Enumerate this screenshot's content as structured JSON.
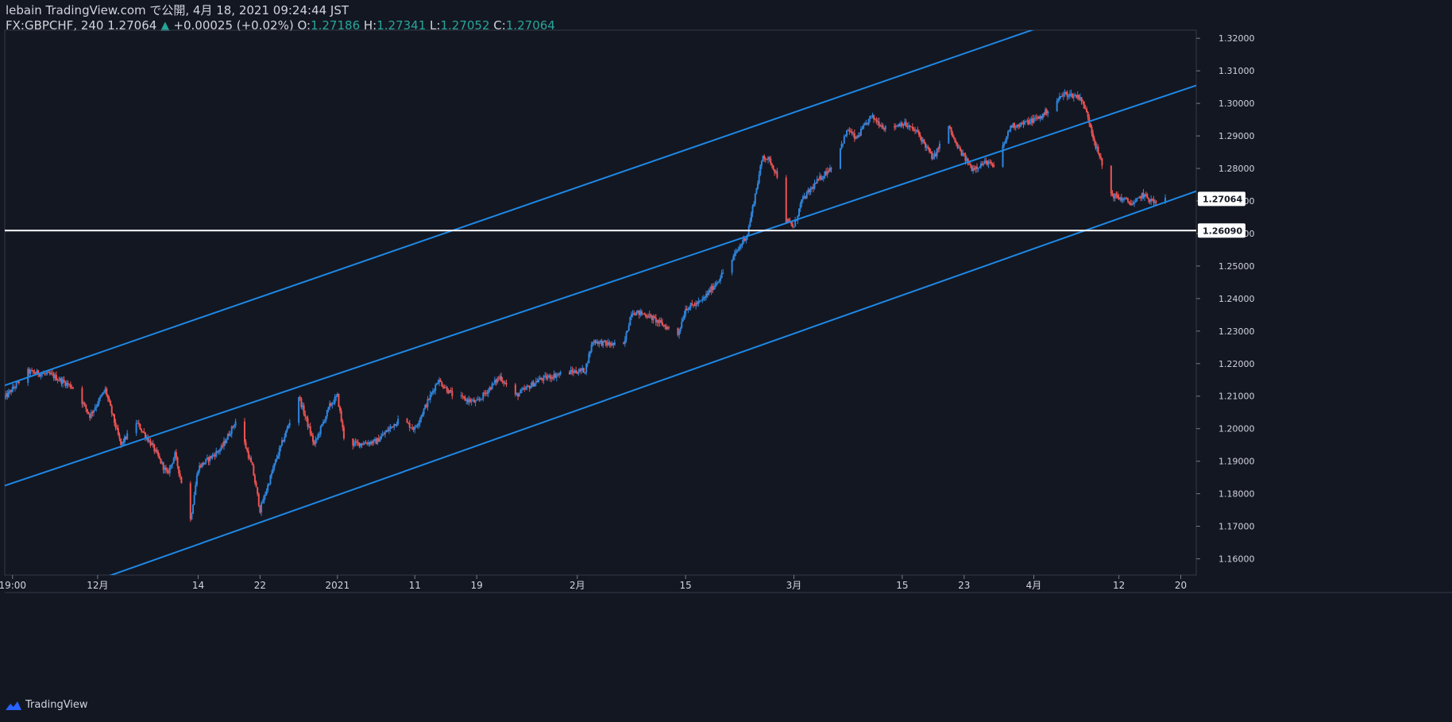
{
  "header": {
    "publisher": "lebain TradingView.com で公開, 4月 18, 2021 09:24:44 JST",
    "symbol": "FX:GBPCHF, 240",
    "last": "1.27064",
    "change_arrow": "▲",
    "change": "+0.00025 (+0.02%)",
    "o_label": "O:",
    "o": "1.27186",
    "h_label": "H:",
    "h": "1.27341",
    "l_label": "L:",
    "l": "1.27052",
    "c_label": "C:",
    "c": "1.27064"
  },
  "footer": {
    "brand": "TradingView",
    "logo_icon": "tradingview-logo-icon"
  },
  "colors": {
    "background": "#131722",
    "up": "#2e86de",
    "down": "#ef5350",
    "channel": "#1e88e5",
    "hline": "#ffffff",
    "axis_text": "#d1d4dc",
    "ohlc": "#26a69a"
  },
  "chart_data": {
    "type": "candlestick",
    "y_axis": {
      "range": [
        1.155,
        1.3225
      ],
      "ticks": [
        "1.16000",
        "1.17000",
        "1.18000",
        "1.19000",
        "1.20000",
        "1.21000",
        "1.22000",
        "1.23000",
        "1.24000",
        "1.25000",
        "1.26000",
        "1.27000",
        "1.28000",
        "1.29000",
        "1.30000",
        "1.31000",
        "1.32000"
      ],
      "tick_values": [
        1.16,
        1.17,
        1.18,
        1.19,
        1.2,
        1.21,
        1.22,
        1.23,
        1.24,
        1.25,
        1.26,
        1.27,
        1.28,
        1.29,
        1.3,
        1.31,
        1.32
      ]
    },
    "x_axis": {
      "range": [
        "2020-11-19",
        "2021-04-22"
      ],
      "ticks": [
        {
          "label": "19:00",
          "date": "2020-11-20"
        },
        {
          "label": "12月",
          "date": "2020-12-01"
        },
        {
          "label": "14",
          "date": "2020-12-14"
        },
        {
          "label": "22",
          "date": "2020-12-22"
        },
        {
          "label": "2021",
          "date": "2021-01-01"
        },
        {
          "label": "11",
          "date": "2021-01-11"
        },
        {
          "label": "19",
          "date": "2021-01-19"
        },
        {
          "label": "2月",
          "date": "2021-02-01"
        },
        {
          "label": "15",
          "date": "2021-02-15"
        },
        {
          "label": "3月",
          "date": "2021-03-01"
        },
        {
          "label": "15",
          "date": "2021-03-15"
        },
        {
          "label": "23",
          "date": "2021-03-23"
        },
        {
          "label": "4月",
          "date": "2021-04-01"
        },
        {
          "label": "12",
          "date": "2021-04-12"
        },
        {
          "label": "20",
          "date": "2021-04-20"
        }
      ]
    },
    "series": [
      {
        "name": "GBPCHF",
        "close_path": [
          {
            "date": "2020-11-19",
            "price": 1.2095
          },
          {
            "date": "2020-11-22",
            "price": 1.2175
          },
          {
            "date": "2020-11-25",
            "price": 1.2165
          },
          {
            "date": "2020-11-28",
            "price": 1.2125
          },
          {
            "date": "2020-11-30",
            "price": 1.204
          },
          {
            "date": "2020-12-02",
            "price": 1.212
          },
          {
            "date": "2020-12-04",
            "price": 1.195
          },
          {
            "date": "2020-12-06",
            "price": 1.202
          },
          {
            "date": "2020-12-08",
            "price": 1.195
          },
          {
            "date": "2020-12-10",
            "price": 1.186
          },
          {
            "date": "2020-12-11",
            "price": 1.192
          },
          {
            "date": "2020-12-13",
            "price": 1.172
          },
          {
            "date": "2020-12-14",
            "price": 1.188
          },
          {
            "date": "2020-12-17",
            "price": 1.194
          },
          {
            "date": "2020-12-19",
            "price": 1.203
          },
          {
            "date": "2020-12-21",
            "price": 1.188
          },
          {
            "date": "2020-12-22",
            "price": 1.175
          },
          {
            "date": "2020-12-24",
            "price": 1.19
          },
          {
            "date": "2020-12-27",
            "price": 1.21
          },
          {
            "date": "2020-12-29",
            "price": 1.195
          },
          {
            "date": "2020-12-31",
            "price": 1.207
          },
          {
            "date": "2021-01-01",
            "price": 1.21
          },
          {
            "date": "2021-01-02",
            "price": 1.195
          },
          {
            "date": "2021-01-06",
            "price": 1.196
          },
          {
            "date": "2021-01-09",
            "price": 1.203
          },
          {
            "date": "2021-01-11",
            "price": 1.2
          },
          {
            "date": "2021-01-14",
            "price": 1.215
          },
          {
            "date": "2021-01-16",
            "price": 1.21
          },
          {
            "date": "2021-01-19",
            "price": 1.208
          },
          {
            "date": "2021-01-22",
            "price": 1.216
          },
          {
            "date": "2021-01-24",
            "price": 1.21
          },
          {
            "date": "2021-01-27",
            "price": 1.215
          },
          {
            "date": "2021-01-30",
            "price": 1.217
          },
          {
            "date": "2021-02-02",
            "price": 1.218
          },
          {
            "date": "2021-02-03",
            "price": 1.227
          },
          {
            "date": "2021-02-05",
            "price": 1.226
          },
          {
            "date": "2021-02-07",
            "price": 1.2255
          },
          {
            "date": "2021-02-08",
            "price": 1.236
          },
          {
            "date": "2021-02-10",
            "price": 1.235
          },
          {
            "date": "2021-02-12",
            "price": 1.232
          },
          {
            "date": "2021-02-14",
            "price": 1.229
          },
          {
            "date": "2021-02-15",
            "price": 1.237
          },
          {
            "date": "2021-02-17",
            "price": 1.239
          },
          {
            "date": "2021-02-19",
            "price": 1.245
          },
          {
            "date": "2021-02-21",
            "price": 1.252
          },
          {
            "date": "2021-02-23",
            "price": 1.26
          },
          {
            "date": "2021-02-24",
            "price": 1.272
          },
          {
            "date": "2021-02-25",
            "price": 1.284
          },
          {
            "date": "2021-02-26",
            "price": 1.282
          },
          {
            "date": "2021-02-27",
            "price": 1.277
          },
          {
            "date": "2021-02-28",
            "price": 1.264
          },
          {
            "date": "2021-03-01",
            "price": 1.262
          },
          {
            "date": "2021-03-02",
            "price": 1.27
          },
          {
            "date": "2021-03-04",
            "price": 1.276
          },
          {
            "date": "2021-03-06",
            "price": 1.281
          },
          {
            "date": "2021-03-08",
            "price": 1.292
          },
          {
            "date": "2021-03-09",
            "price": 1.289
          },
          {
            "date": "2021-03-11",
            "price": 1.296
          },
          {
            "date": "2021-03-13",
            "price": 1.292
          },
          {
            "date": "2021-03-15",
            "price": 1.294
          },
          {
            "date": "2021-03-17",
            "price": 1.291
          },
          {
            "date": "2021-03-19",
            "price": 1.283
          },
          {
            "date": "2021-03-21",
            "price": 1.293
          },
          {
            "date": "2021-03-22",
            "price": 1.287
          },
          {
            "date": "2021-03-24",
            "price": 1.28
          },
          {
            "date": "2021-03-26",
            "price": 1.282
          },
          {
            "date": "2021-03-27",
            "price": 1.28
          },
          {
            "date": "2021-03-29",
            "price": 1.293
          },
          {
            "date": "2021-03-31",
            "price": 1.294
          },
          {
            "date": "2021-04-02",
            "price": 1.296
          },
          {
            "date": "2021-04-04",
            "price": 1.301
          },
          {
            "date": "2021-04-05",
            "price": 1.303
          },
          {
            "date": "2021-04-07",
            "price": 1.302
          },
          {
            "date": "2021-04-08",
            "price": 1.296
          },
          {
            "date": "2021-04-09",
            "price": 1.287
          },
          {
            "date": "2021-04-10",
            "price": 1.28
          },
          {
            "date": "2021-04-11",
            "price": 1.272
          },
          {
            "date": "2021-04-13",
            "price": 1.27
          },
          {
            "date": "2021-04-14",
            "price": 1.269
          },
          {
            "date": "2021-04-15",
            "price": 1.272
          },
          {
            "date": "2021-04-17",
            "price": 1.269
          },
          {
            "date": "2021-04-18",
            "price": 1.27064
          }
        ]
      }
    ],
    "drawings": {
      "channel_lines": [
        {
          "name": "upper",
          "from": {
            "date": "2020-11-19",
            "price": 1.2133
          },
          "to": {
            "date": "2021-04-22",
            "price": 1.34
          }
        },
        {
          "name": "middle",
          "from": {
            "date": "2020-11-19",
            "price": 1.1825
          },
          "to": {
            "date": "2021-04-22",
            "price": 1.3055
          }
        },
        {
          "name": "lower",
          "from": {
            "date": "2020-12-01",
            "price": 1.1535
          },
          "to": {
            "date": "2021-04-22",
            "price": 1.273
          }
        }
      ],
      "horizontal_line": {
        "price": 1.2609,
        "label": "1.26090"
      },
      "last_price_label": {
        "price": 1.27064,
        "label": "1.27064"
      }
    },
    "grid": false
  }
}
